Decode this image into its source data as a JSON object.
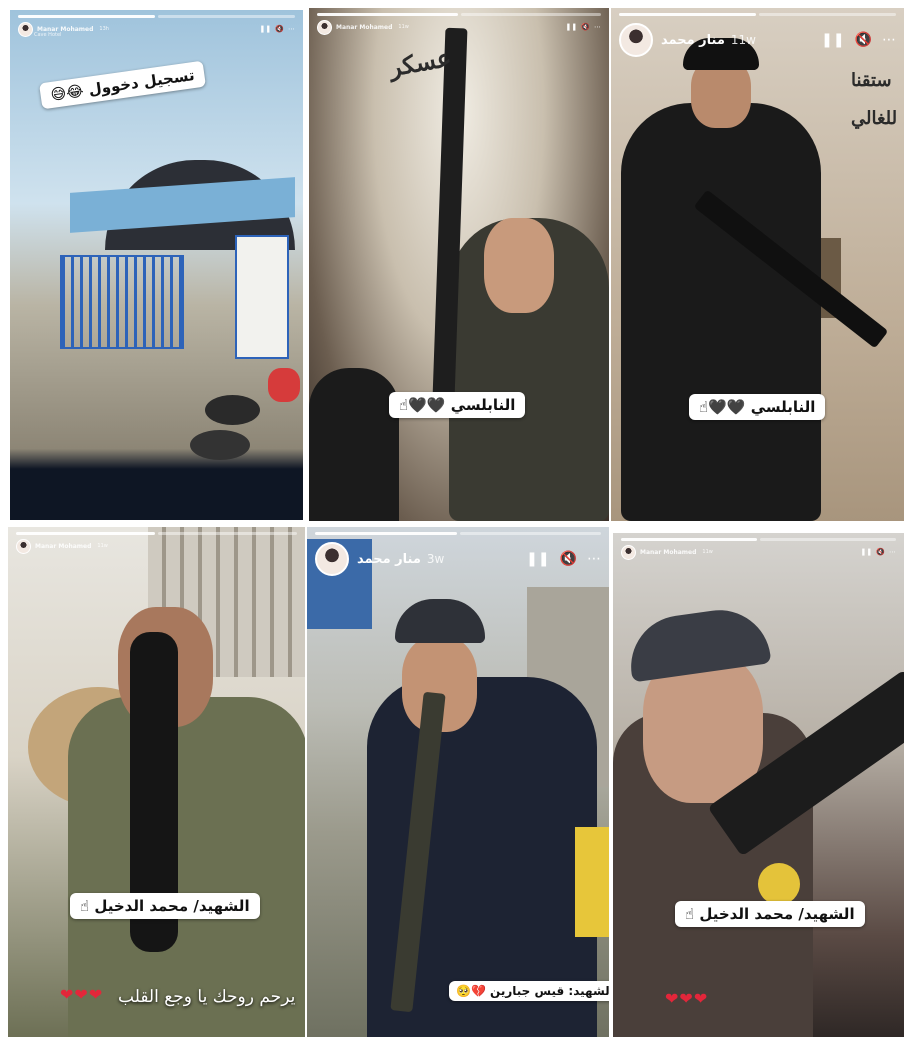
{
  "stories": [
    {
      "username": "Manar Mohamed",
      "time": "13h",
      "subtitle": "Cave Hotel",
      "sticker": "تسجيل دخوول 😂😅"
    },
    {
      "username": "Manar Mohamed",
      "time": "11w",
      "mural": "عسكر",
      "sticker": "النابلسي 🖤🖤☝"
    },
    {
      "username": "منار محمد",
      "time": "11w",
      "mural_top": "ستقنا",
      "mural_bottom": "للغالي",
      "sticker": "النابلسي 🖤🖤☝"
    },
    {
      "username": "Manar Mohamed",
      "time": "11w",
      "sticker": "الشهيد/ محمد الدخيل ☝",
      "script": "يرحم روحك يا وجع القلب",
      "hearts": "❤❤❤"
    },
    {
      "username": "منار محمد",
      "time": "3w",
      "sticker": "الشهيد: قيس جبارين 💔🥺"
    },
    {
      "username": "Manar Mohamed",
      "time": "11w",
      "sticker": "الشهيد/ محمد الدخيل ☝",
      "hearts": "❤❤❤"
    }
  ]
}
